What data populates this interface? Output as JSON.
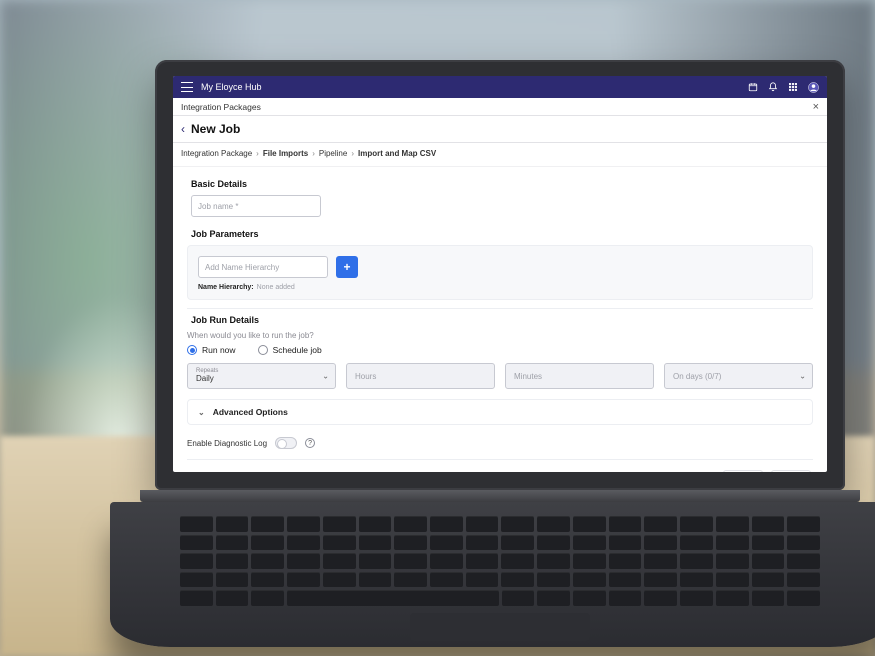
{
  "topbar": {
    "app_title": "My Eloyce Hub"
  },
  "subheader": {
    "title": "Integration Packages"
  },
  "page": {
    "title": "New Job"
  },
  "breadcrumbs": {
    "items": [
      "Integration Package",
      "File Imports",
      "Pipeline",
      "Import and Map CSV"
    ]
  },
  "sections": {
    "basic_details": {
      "title": "Basic Details",
      "job_name_placeholder": "Job name *"
    },
    "job_parameters": {
      "title": "Job Parameters",
      "add_name_hierarchy_placeholder": "Add Name Hierarchy",
      "name_hierarchy_label": "Name Hierarchy:",
      "name_hierarchy_value": "None added"
    },
    "job_run_details": {
      "title": "Job Run Details",
      "question": "When would you like to run the job?",
      "radios": {
        "run_now": "Run now",
        "schedule_job": "Schedule job"
      },
      "selected": "run_now",
      "repeats": {
        "label": "Repeats",
        "value": "Daily"
      },
      "hours_placeholder": "Hours",
      "minutes_placeholder": "Minutes",
      "on_days": {
        "value": "On days (0/7)"
      }
    },
    "advanced": {
      "title": "Advanced Options"
    },
    "diagnostic": {
      "label": "Enable Diagnostic Log",
      "enabled": false
    }
  }
}
